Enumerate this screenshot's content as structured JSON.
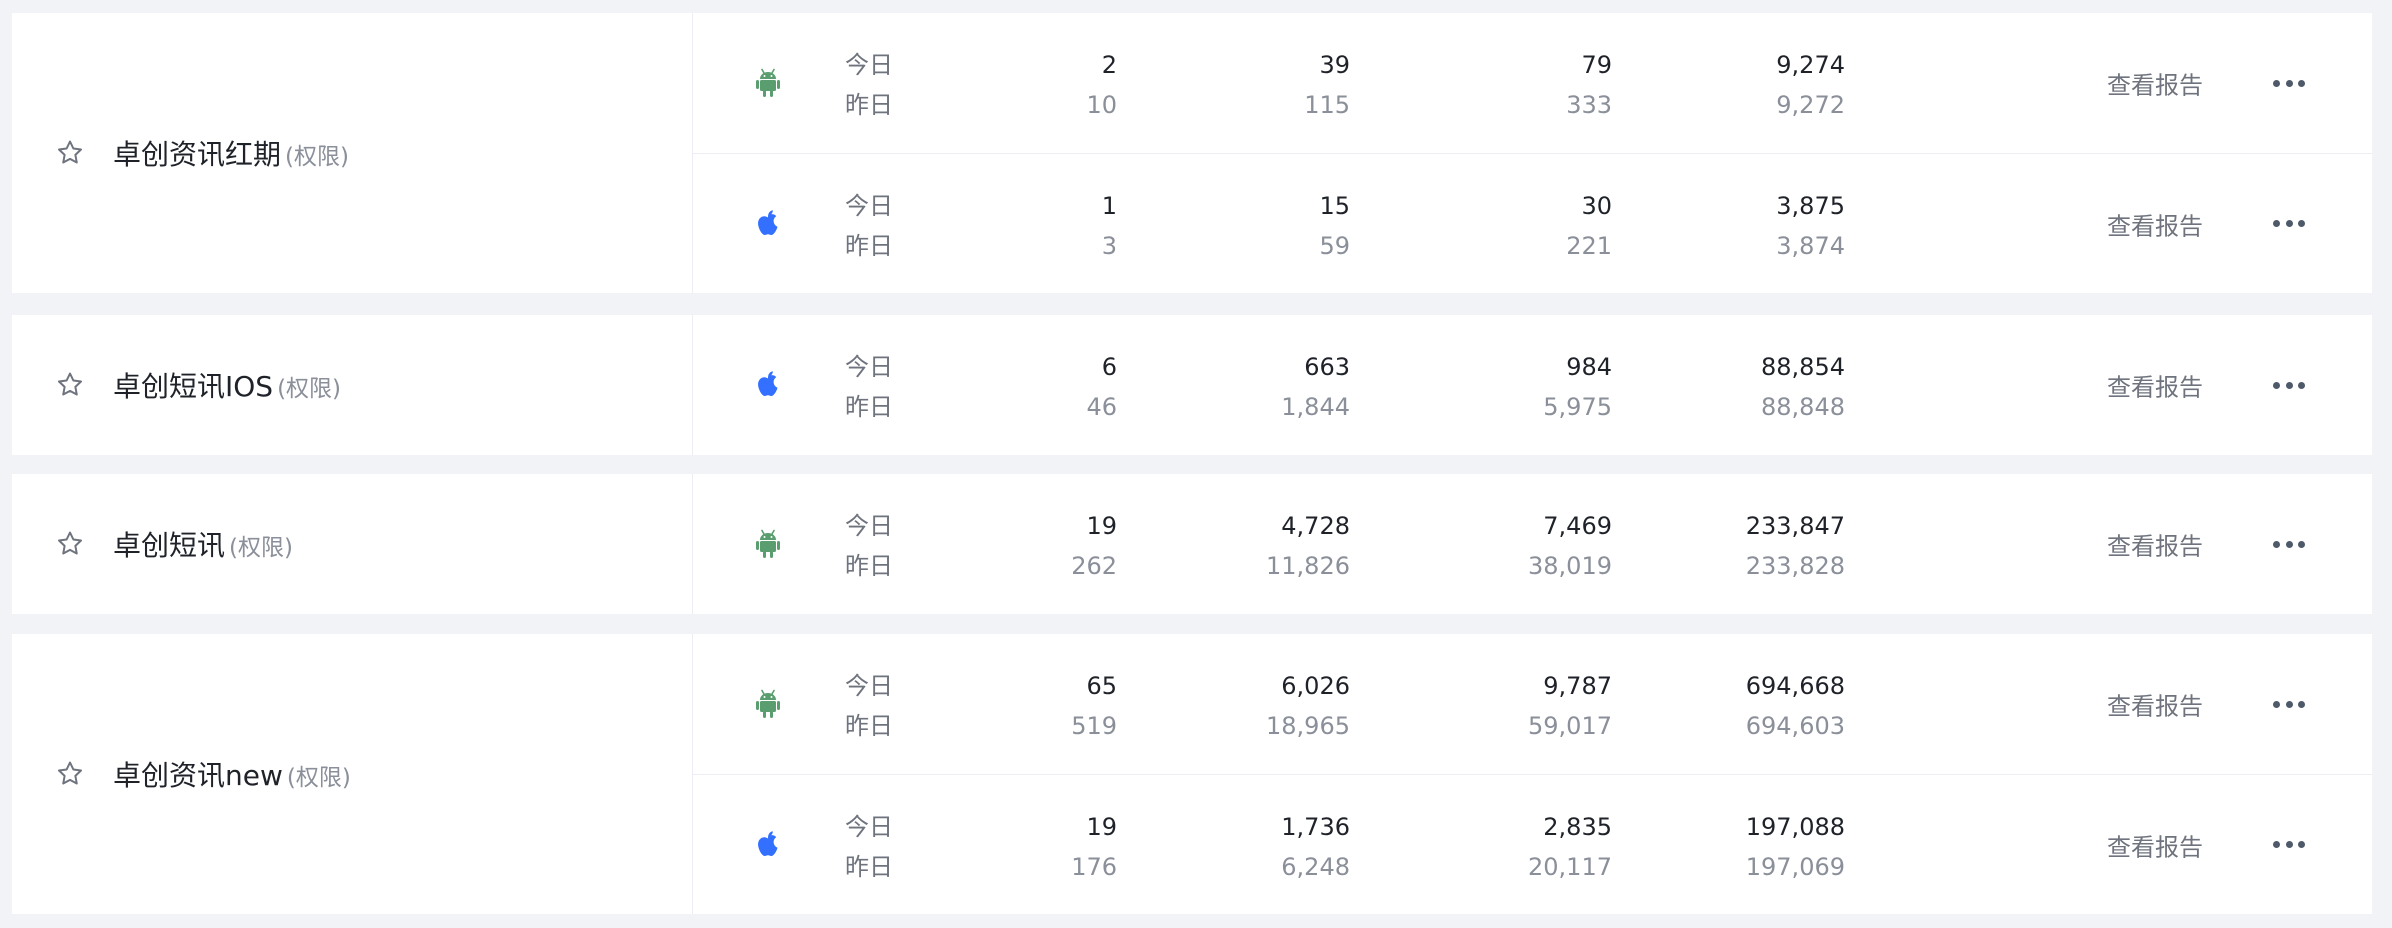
{
  "labels": {
    "today": "今日",
    "yesterday": "昨日",
    "report": "查看报告",
    "permission": "(权限)"
  },
  "colors": {
    "android": "#5a9e6f",
    "ios": "#3370ff",
    "background": "#f2f3f7"
  },
  "apps": [
    {
      "name": "卓创资讯红期",
      "rows": [
        {
          "platform": "android-icon",
          "metrics": [
            [
              "2",
              "10"
            ],
            [
              "39",
              "115"
            ],
            [
              "79",
              "333"
            ],
            [
              "9,274",
              "9,272"
            ]
          ]
        },
        {
          "platform": "apple-icon",
          "metrics": [
            [
              "1",
              "3"
            ],
            [
              "15",
              "59"
            ],
            [
              "30",
              "221"
            ],
            [
              "3,875",
              "3,874"
            ]
          ]
        }
      ]
    },
    {
      "name": "卓创短讯IOS",
      "rows": [
        {
          "platform": "apple-icon",
          "metrics": [
            [
              "6",
              "46"
            ],
            [
              "663",
              "1,844"
            ],
            [
              "984",
              "5,975"
            ],
            [
              "88,854",
              "88,848"
            ]
          ]
        }
      ]
    },
    {
      "name": "卓创短讯",
      "rows": [
        {
          "platform": "android-icon",
          "metrics": [
            [
              "19",
              "262"
            ],
            [
              "4,728",
              "11,826"
            ],
            [
              "7,469",
              "38,019"
            ],
            [
              "233,847",
              "233,828"
            ]
          ]
        }
      ]
    },
    {
      "name": "卓创资讯new",
      "rows": [
        {
          "platform": "android-icon",
          "metrics": [
            [
              "65",
              "519"
            ],
            [
              "6,026",
              "18,965"
            ],
            [
              "9,787",
              "59,017"
            ],
            [
              "694,668",
              "694,603"
            ]
          ]
        },
        {
          "platform": "apple-icon",
          "metrics": [
            [
              "19",
              "176"
            ],
            [
              "1,736",
              "6,248"
            ],
            [
              "2,835",
              "20,117"
            ],
            [
              "197,088",
              "197,069"
            ]
          ]
        }
      ]
    }
  ]
}
